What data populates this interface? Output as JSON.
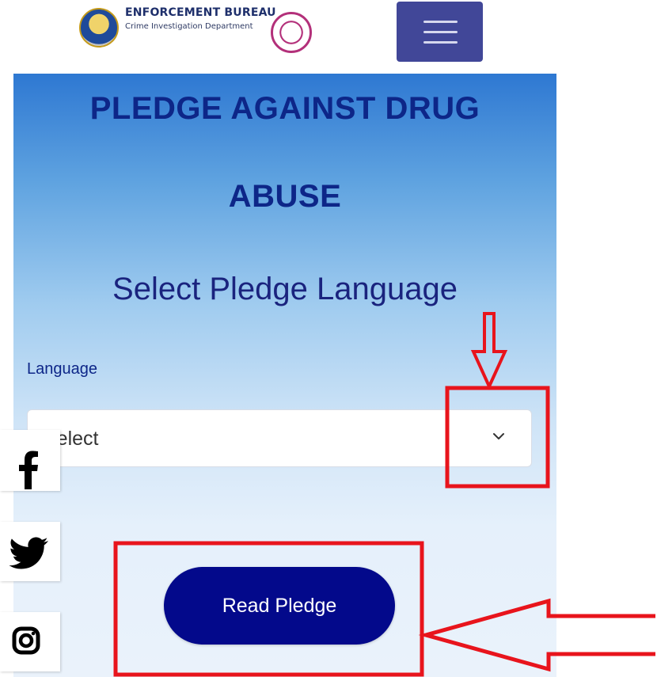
{
  "header": {
    "brand_title": "ENFORCEMENT BUREAU",
    "brand_subtitle": "Crime Investigation Department",
    "menu_icon": "hamburger-menu-icon"
  },
  "main": {
    "title_line1": "PLEDGE AGAINST DRUG",
    "title_line2": "ABUSE",
    "subtitle": "Select Pledge Language",
    "language_label": "Language",
    "language_select_value": "Select",
    "read_button_label": "Read Pledge"
  },
  "social": {
    "icons": [
      "facebook-icon",
      "twitter-icon",
      "instagram-icon"
    ]
  },
  "colors": {
    "brand_blue": "#0d2688",
    "button_blue": "#03098b",
    "menu_purple": "#414798",
    "annotation_red": "#e8141c"
  }
}
